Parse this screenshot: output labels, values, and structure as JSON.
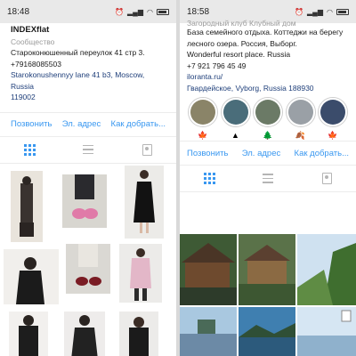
{
  "left": {
    "status": {
      "time": "18:48"
    },
    "profile": {
      "name": "INDEXflat",
      "category": "Сообщество",
      "address_ru": "Староконюшенный переулок 41 стр 3.",
      "phone": "+79168085503",
      "address_en_line1": "Starokonushennyy lane 41 b3, Moscow, Russia",
      "address_en_line2": "119002"
    },
    "actions": {
      "call": "Позвонить",
      "email": "Эл. адрес",
      "directions": "Как добрать..."
    }
  },
  "right": {
    "status": {
      "time": "18:58"
    },
    "profile": {
      "line0": "Загородный клуб Клубный дом",
      "line1": "База семейного отдыха. Коттеджи на берегу",
      "line2": "лесного озера. Россия, Выборг.",
      "line3": "Wonderful resort place. Russia",
      "phone": "+7 921 796 45 49",
      "link": "iloranta.ru/",
      "location": "Гвардейское, Vyborg, Russia 188930"
    },
    "highlights": [
      "🍁",
      "▲",
      "🌲",
      "🍂",
      "🍁",
      "🍁"
    ],
    "actions": {
      "call": "Позвонить",
      "email": "Эл. адрес",
      "directions": "Как добрать..."
    }
  },
  "colors": {
    "accent": "#3897f0",
    "link_dark": "#1f3f7a",
    "muted": "#9b9b9b"
  }
}
